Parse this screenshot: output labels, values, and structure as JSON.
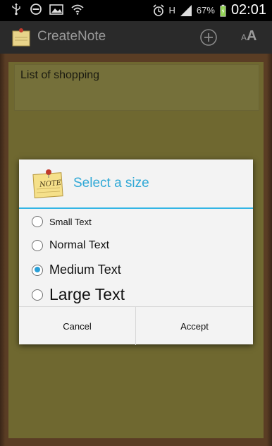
{
  "status_bar": {
    "battery_percent": "67%",
    "time": "02:01",
    "network_letter": "H"
  },
  "action_bar": {
    "title": "CreateNote",
    "font_small": "A",
    "font_large": "A"
  },
  "note": {
    "text": "List of shopping"
  },
  "dialog": {
    "title": "Select a size",
    "icon_text": "NOTE",
    "options": [
      {
        "label": "Small Text",
        "checked": false
      },
      {
        "label": "Normal Text",
        "checked": false
      },
      {
        "label": "Medium Text",
        "checked": true
      },
      {
        "label": "Large Text",
        "checked": false
      }
    ],
    "cancel_label": "Cancel",
    "accept_label": "Accept"
  },
  "colors": {
    "accent": "#33b5e5",
    "title_color": "#2fa8d6"
  }
}
